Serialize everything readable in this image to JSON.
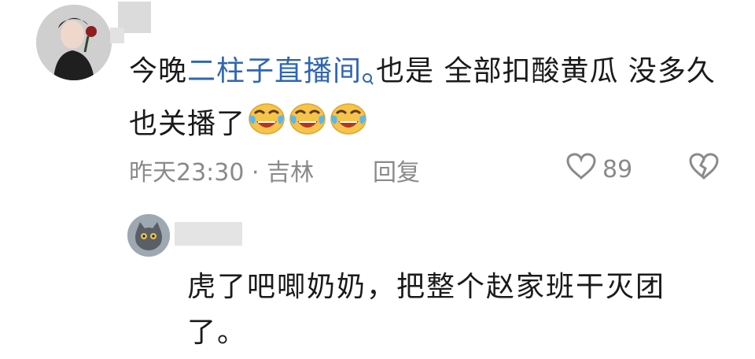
{
  "comment": {
    "text_before": "今晚",
    "link_text": "二柱子直播间",
    "text_after": "也是 全部扣酸黄瓜 没多久也关播了",
    "emoji_count": 3,
    "emoji_icon": "cry-laugh-emoji",
    "time": "昨天23:30 · 吉林",
    "reply_label": "回复",
    "like_count": "89"
  },
  "reply": {
    "text": "虎了吧唧奶奶，把整个赵家班干灭团了。"
  },
  "colors": {
    "link": "#2f66b3",
    "meta": "#8a8a8a",
    "text": "#1a1a1a"
  }
}
